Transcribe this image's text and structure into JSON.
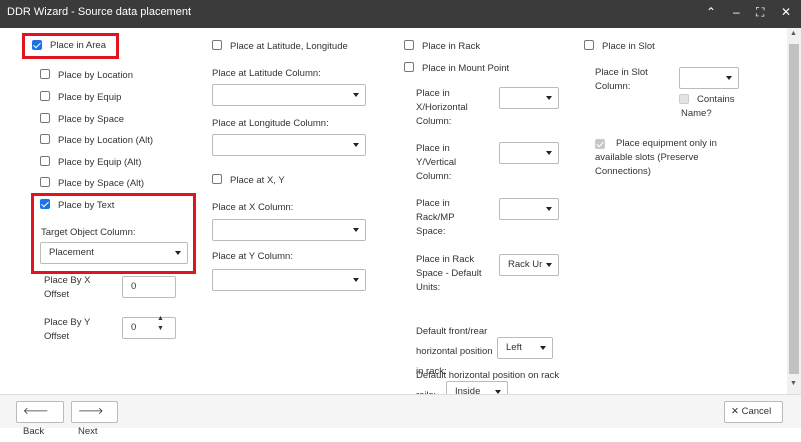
{
  "title": "DDR Wizard - Source data placement",
  "window_controls": {
    "collapse": "⌃",
    "minimize": "–",
    "maximize": "⛶",
    "close": "✕"
  },
  "col1": {
    "place_in_area": "Place in Area",
    "place_by_location": "Place by Location",
    "place_by_equip": "Place by Equip",
    "place_by_space": "Place by Space",
    "place_by_location_alt": "Place by Location (Alt)",
    "place_by_equip_alt": "Place by Equip (Alt)",
    "place_by_space_alt": "Place by Space (Alt)",
    "place_by_text": "Place by Text",
    "target_object_column_label": "Target Object Column:",
    "target_object_column_value": "Placement",
    "x_offset_label": "Place By X Offset",
    "x_offset_value": "0",
    "y_offset_label": "Place By Y Offset",
    "y_offset_value": "0"
  },
  "col2": {
    "place_at_lat_long": "Place at Latitude, Longitude",
    "lat_column_label": "Place at Latitude Column:",
    "long_column_label": "Place at Longitude Column:",
    "place_at_xy": "Place at X, Y",
    "x_column_label": "Place at X Column:",
    "y_column_label": "Place at Y Column:"
  },
  "col3": {
    "place_in_rack": "Place in Rack",
    "place_in_mount_point": "Place in Mount Point",
    "x_horizontal_label": "Place in X/Horizontal Column:",
    "y_vertical_label": "Place in Y/Vertical Column:",
    "rack_mp_space_label": "Place in Rack/MP Space:",
    "rack_space_default_label": "Place in Rack Space - Default Units:",
    "rack_space_default_value": "Rack Ur",
    "front_rear_label": "Default front/rear horizontal position in rack:",
    "front_rear_value": "Left",
    "horizontal_rails_label": "Default horizontal position on rack rails:",
    "horizontal_rails_value": "Inside"
  },
  "col4": {
    "place_in_slot": "Place in Slot",
    "slot_column_label": "Place in Slot Column:",
    "contains_name": "Contains Name?",
    "available_slots": "Place equipment only in available slots (Preserve Connections)"
  },
  "footer": {
    "back": "Back",
    "next": "Next",
    "cancel": "Cancel"
  }
}
